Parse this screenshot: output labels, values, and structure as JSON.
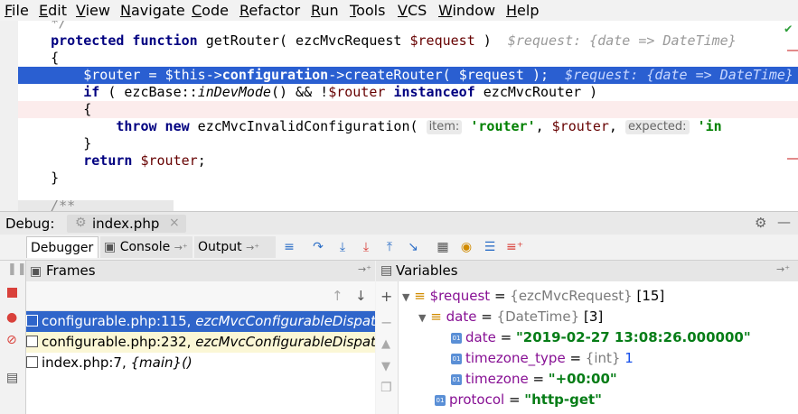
{
  "menu": [
    {
      "label": "File",
      "u": "F",
      "rest": "ile"
    },
    {
      "label": "Edit",
      "u": "E",
      "rest": "dit"
    },
    {
      "label": "View",
      "u": "V",
      "rest": "iew"
    },
    {
      "label": "Navigate",
      "u": "N",
      "rest": "avigate"
    },
    {
      "label": "Code",
      "u": "C",
      "rest": "ode"
    },
    {
      "label": "Refactor",
      "u": "R",
      "rest": "efactor"
    },
    {
      "label": "Run",
      "u": "R",
      "rest": "un"
    },
    {
      "label": "Tools",
      "u": "T",
      "rest": "ools"
    },
    {
      "label": "VCS",
      "u": "V",
      "rest": "CS"
    },
    {
      "label": "Window",
      "u": "W",
      "rest": "indow"
    },
    {
      "label": "Help",
      "u": "H",
      "rest": "elp"
    }
  ],
  "editor": {
    "line0": "*/",
    "line1": {
      "kw1": "protected function",
      "fn": " getRouter( ezcMvcRequest ",
      "var": "$request",
      " close": " )",
      "hint": "$request: {date => DateTime}"
    },
    "line2": "{",
    "line3": {
      "var1": "$router",
      "a": " = ",
      "var2": "$this",
      "arrow1": "->",
      "prop": "configuration",
      "arrow2": "->createRouter( ",
      "var3": "$request",
      "close": " );",
      "hint": "$request: {date => DateTime}"
    },
    "line4": {
      "kw": "if",
      "a": " ( ezcBase::",
      "m": "inDevMode",
      "b": "() && !",
      "var": "$router",
      "c": " ",
      "kw2": "instanceof",
      "d": " ezcMvcRouter )"
    },
    "line5": "{",
    "line6": {
      "kw": "throw new",
      "a": " ezcMvcInvalidConfiguration(",
      "inlay1": "item:",
      "str1": "'router'",
      "b": ", ",
      "var": "$router",
      "c": ",",
      "inlay2": "expected:",
      "str2": "'in"
    },
    "line7": "}",
    "line8": {
      "kw": "return",
      "var": " $router",
      "a": ";"
    },
    "line9": "}",
    "line10": "/**"
  },
  "debug": {
    "label": "Debug:",
    "tab_label": "index.php",
    "tabs": {
      "debugger": "Debugger",
      "console": "Console",
      "output": "Output"
    }
  },
  "frames": {
    "title": "Frames",
    "rows": [
      {
        "file": "configurable.php:115, ",
        "method": "ezcMvcConfigurableDispatcher->createRouter()"
      },
      {
        "file": "configurable.php:232, ",
        "method": "ezcMvcConfigurableDispatcher->run()"
      },
      {
        "file": "index.php:7, ",
        "method": "{main}()"
      }
    ]
  },
  "variables": {
    "title": "Variables",
    "rows": [
      {
        "name": "$request",
        "eq": " = ",
        "type": "{ezcMvcRequest}",
        "extra": " [15]"
      },
      {
        "name": "date",
        "eq": " = ",
        "type": "{DateTime}",
        "extra": " [3]"
      },
      {
        "name": "date",
        "eq": " = ",
        "val": "\"2019-02-27 13:08:26.000000\""
      },
      {
        "name": "timezone_type",
        "eq": " = ",
        "type": "{int}",
        "num": " 1"
      },
      {
        "name": "timezone",
        "eq": " = ",
        "val": "\"+00:00\""
      },
      {
        "name": "protocol",
        "eq": " = ",
        "val": "\"http-get\""
      }
    ]
  }
}
